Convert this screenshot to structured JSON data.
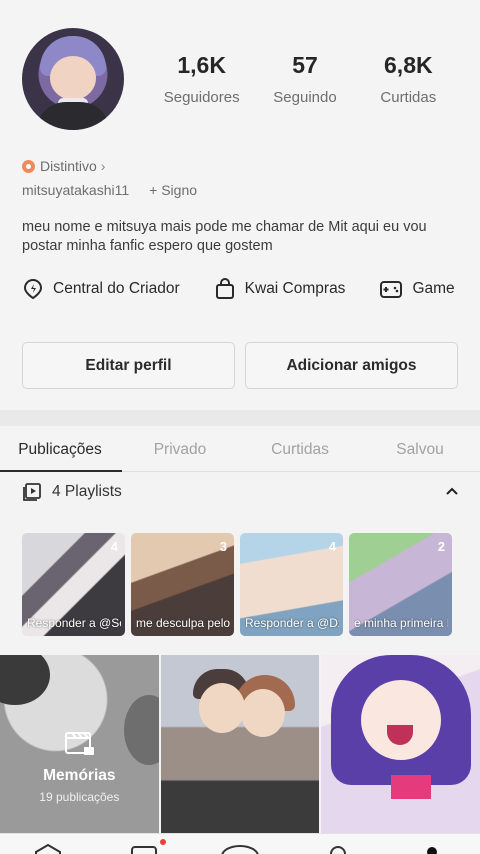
{
  "stats": [
    {
      "value": "1,6K",
      "label": "Seguidores"
    },
    {
      "value": "57",
      "label": "Seguindo"
    },
    {
      "value": "6,8K",
      "label": "Curtidas"
    }
  ],
  "badge": {
    "label": "Distintivo"
  },
  "user": {
    "handle": "mitsuyatakashi11",
    "sign": "+ Signo"
  },
  "bio": "meu nome e mitsuya mais pode me chamar de Mit aqui eu vou postar minha fanfic espero que gostem",
  "shortcuts": [
    {
      "label": "Central do Criador",
      "icon": "creator-pin-icon"
    },
    {
      "label": "Kwai Compras",
      "icon": "shopping-bag-icon"
    },
    {
      "label": "Game",
      "icon": "gamepad-icon"
    }
  ],
  "actions": {
    "edit": "Editar perfil",
    "add": "Adicionar amigos"
  },
  "tabs": [
    "Publicações",
    "Privado",
    "Curtidas",
    "Salvou"
  ],
  "playlists": {
    "title": "4 Playlists",
    "items": [
      {
        "count": "4",
        "caption": "Responder a @Sonia Nune..."
      },
      {
        "count": "3",
        "caption": "me desculpa pelo atraso m..."
      },
      {
        "count": "4",
        "caption": "Responder a @Dxx kaua..."
      },
      {
        "count": "2",
        "caption": "e minha primeira Fan..."
      }
    ]
  },
  "memories": {
    "title": "Memórias",
    "subtitle": "19 publicações"
  },
  "colors": {
    "accent": "#f08a5d",
    "notification": "#e8413a",
    "active_tab": "#2b2b2b"
  }
}
